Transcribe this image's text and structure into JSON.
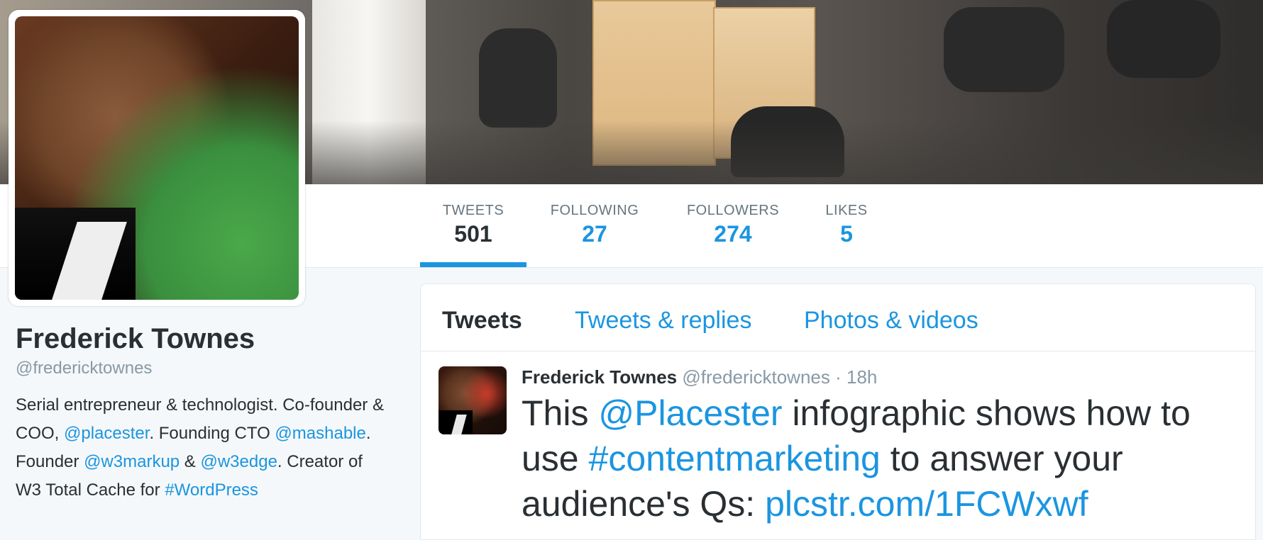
{
  "profile": {
    "name": "Frederick Townes",
    "handle": "@fredericktownes",
    "bio": {
      "p1": "Serial entrepreneur & technologist. Co-founder & COO, ",
      "m1": "@placester",
      "p2": ". Founding CTO ",
      "m2": "@mashable",
      "p3": ". Founder ",
      "m3": "@w3markup",
      "p4": " & ",
      "m4": "@w3edge",
      "p5": ". Creator of W3 Total Cache for ",
      "m5": "#WordPress"
    }
  },
  "stats": [
    {
      "label": "TWEETS",
      "value": "501",
      "active": true
    },
    {
      "label": "FOLLOWING",
      "value": "27"
    },
    {
      "label": "FOLLOWERS",
      "value": "274"
    },
    {
      "label": "LIKES",
      "value": "5"
    }
  ],
  "tabs": [
    {
      "label": "Tweets",
      "active": true
    },
    {
      "label": "Tweets & replies"
    },
    {
      "label": "Photos & videos"
    }
  ],
  "tweet": {
    "name": "Frederick Townes",
    "handle": "@fredericktownes",
    "separator": "·",
    "time": "18h",
    "t1": "This ",
    "l1": "@Placester",
    "t2": " infographic shows how to use ",
    "l2": "#contentmarketing",
    "t3": " to answer your audience's Qs: ",
    "l3": "plcstr.com/1FCWxwf"
  },
  "colors": {
    "accent": "#1b95e0",
    "text": "#292f33",
    "muted": "#8899a6",
    "background": "#f5f8fa"
  }
}
